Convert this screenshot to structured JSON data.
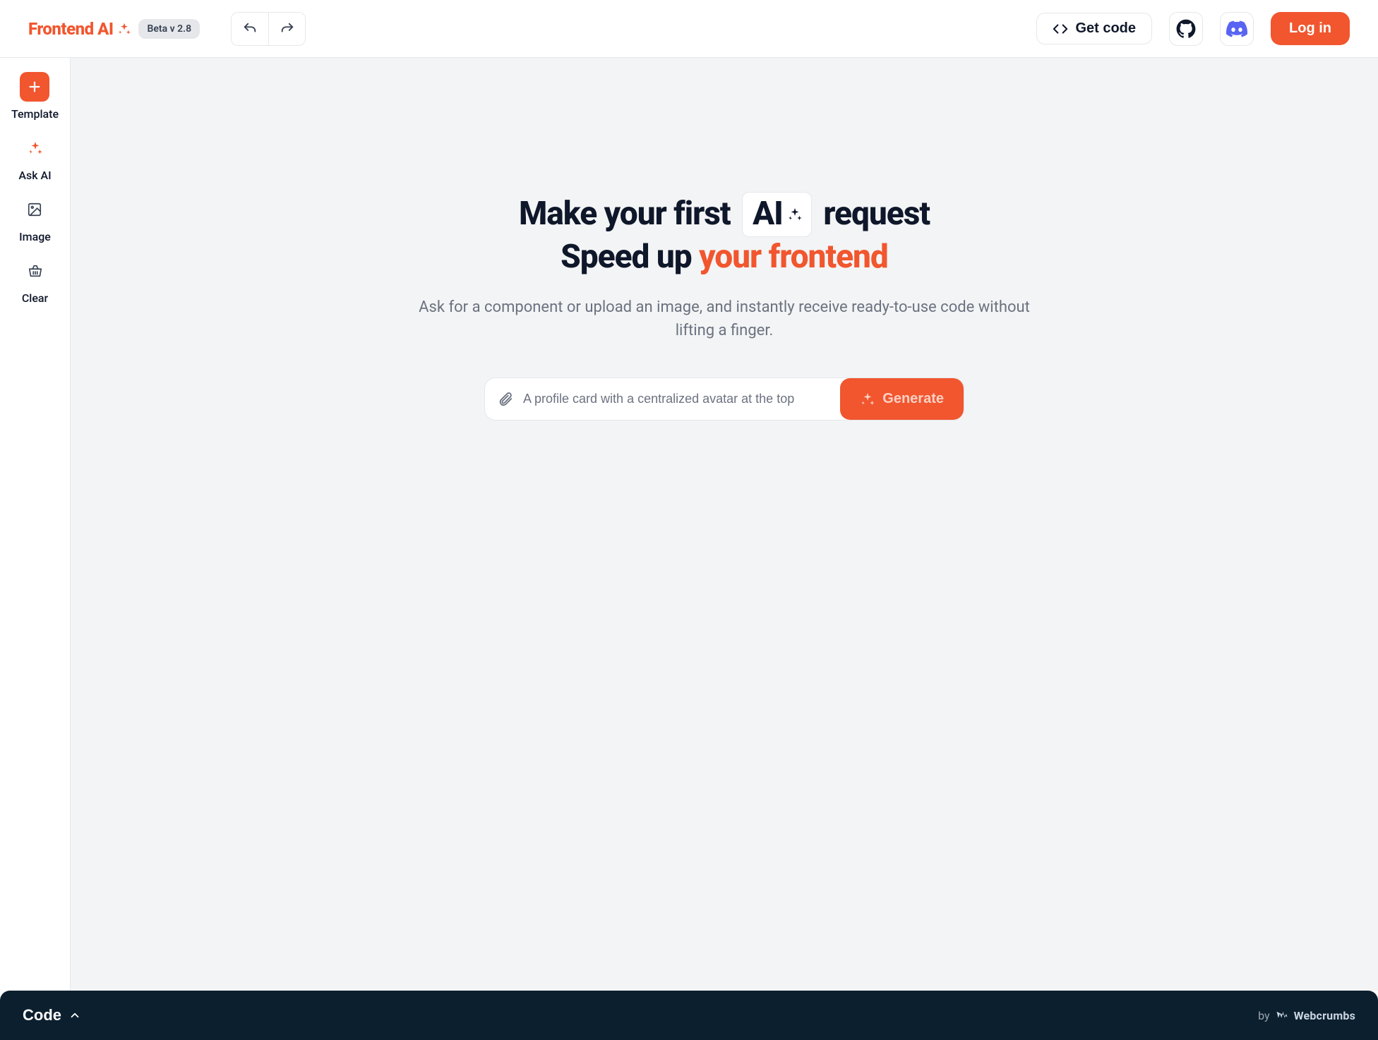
{
  "header": {
    "logo_text": "Frontend AI",
    "beta_label": "Beta v 2.8",
    "get_code_label": "Get code",
    "login_label": "Log in"
  },
  "sidebar": {
    "items": [
      {
        "label": "Template"
      },
      {
        "label": "Ask AI"
      },
      {
        "label": "Image"
      },
      {
        "label": "Clear"
      }
    ]
  },
  "hero": {
    "line1_before": "Make your first ",
    "line1_chip": "AI",
    "line1_after": " request",
    "line2_plain": "Speed up ",
    "line2_accent": "your frontend",
    "subtitle": "Ask for a component or upload an image, and instantly receive ready-to-use code without lifting a finger."
  },
  "prompt": {
    "placeholder": "A profile card with a centralized avatar at the top",
    "generate_label": "Generate"
  },
  "bottom": {
    "code_label": "Code",
    "credits_by": "by",
    "credits_name": "Webcrumbs"
  }
}
